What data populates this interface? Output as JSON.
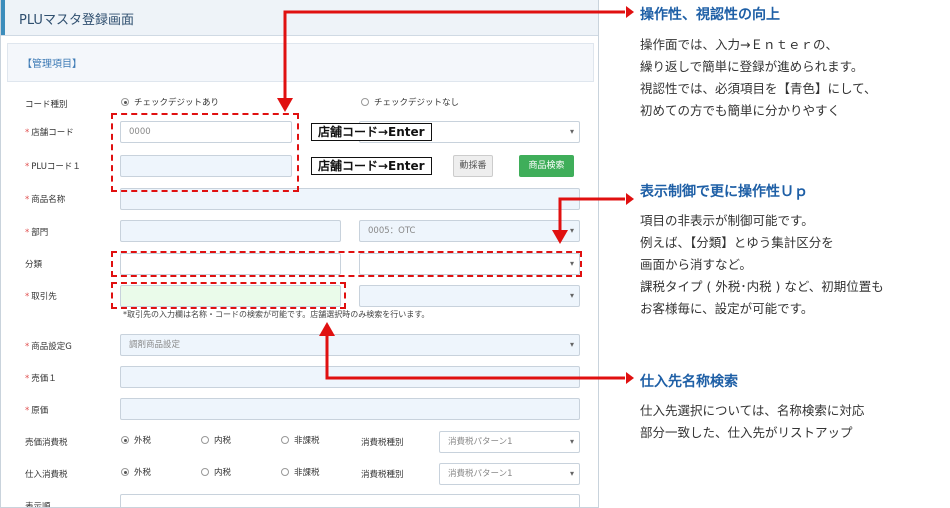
{
  "window": {
    "title": "PLUマスタ登録画面"
  },
  "section": {
    "title": "【管理項目】"
  },
  "form": {
    "code_type": {
      "label": "コード種別",
      "option_with": "チェックデジットあり",
      "option_without": "チェックデジットなし"
    },
    "store_code": {
      "label": "店舗コード",
      "value": "0000"
    },
    "plu_code": {
      "label": "PLUコード１",
      "auto_button": "動採番",
      "search_button": "商品検索"
    },
    "product_name": {
      "label": "商品名称"
    },
    "department": {
      "label": "部門",
      "selected": "0005：OTC"
    },
    "category": {
      "label": "分類"
    },
    "supplier": {
      "label": "取引先",
      "help": "*取引先の入力欄は名称・コードの検索が可能です。店舗選択時のみ検索を行います。"
    },
    "product_setting": {
      "label": "商品設定G",
      "selected": "調剤商品設定"
    },
    "sale_price": {
      "label": "売価１"
    },
    "cost": {
      "label": "原価"
    },
    "sale_tax": {
      "label": "売価消費税",
      "opt1": "外税",
      "opt2": "内税",
      "opt3": "非課税",
      "type_label": "消費税種別",
      "type_value": "消費税パターン1"
    },
    "purchase_tax": {
      "label": "仕入消費税",
      "opt1": "外税",
      "opt2": "内税",
      "opt3": "非課税",
      "type_label": "消費税種別",
      "type_value": "消費税パターン1"
    },
    "display_order": {
      "label": "表示順"
    }
  },
  "callouts": {
    "tag1": "店舗コード→Enter",
    "tag2": "店舗コード→Enter"
  },
  "notes": {
    "n1": {
      "title": "操作性、視認性の向上",
      "lines": [
        "操作面では、入力→Ｅｎｔｅｒの、",
        "繰り返しで簡単に登録が進められます。",
        "視認性では、必須項目を【青色】にして、",
        "初めての方でも簡単に分かりやすく"
      ]
    },
    "n2": {
      "title": "表示制御で更に操作性Ｕｐ",
      "lines": [
        "項目の非表示が制御可能です。",
        "例えば、【分類】とゆう集計区分を",
        "画面から消すなど。",
        "課税タイプ ( 外税･内税 ) など、初期位置も",
        "お客様毎に、設定が可能です。"
      ]
    },
    "n3": {
      "title": "仕入先名称検索",
      "lines": [
        "仕入先選択については、名称検索に対応",
        "部分一致した、仕入先がリストアップ"
      ]
    }
  },
  "colors": {
    "accent": "#3c8dbc",
    "callout": "#e01010",
    "title_blue": "#1e5fa6"
  }
}
